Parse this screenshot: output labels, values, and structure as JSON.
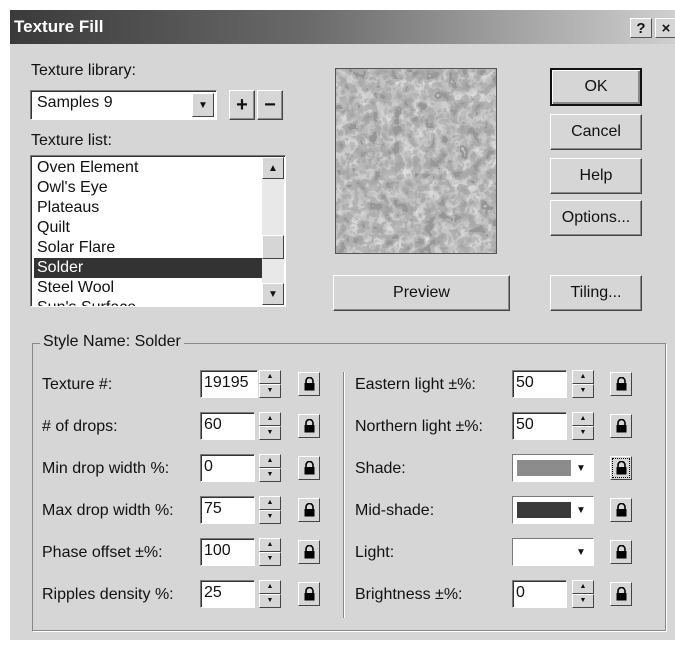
{
  "window": {
    "title": "Texture Fill",
    "help_glyph": "?",
    "close_glyph": "×"
  },
  "library": {
    "label": "Texture library:",
    "value": "Samples 9",
    "add": "+",
    "remove": "−"
  },
  "texture_list": {
    "label": "Texture list:",
    "items": [
      "Oven Element",
      "Owl's Eye",
      "Plateaus",
      "Quilt",
      "Solar Flare",
      "Solder",
      "Steel Wool",
      "Sun's Surface"
    ],
    "selected": "Solder"
  },
  "buttons": {
    "ok": "OK",
    "cancel": "Cancel",
    "help": "Help",
    "options": "Options...",
    "preview": "Preview",
    "tiling": "Tiling..."
  },
  "style": {
    "group_title": "Style Name: Solder",
    "left_params": [
      {
        "label": "Texture #:",
        "value": "19195"
      },
      {
        "label": "# of drops:",
        "value": "60"
      },
      {
        "label": "Min drop width %:",
        "value": "0"
      },
      {
        "label": "Max drop width %:",
        "value": "75"
      },
      {
        "label": "Phase offset ±%:",
        "value": "100"
      },
      {
        "label": "Ripples density %:",
        "value": "25"
      }
    ],
    "right_params": [
      {
        "label": "Eastern light ±%:",
        "value": "50"
      },
      {
        "label": "Northern light ±%:",
        "value": "50"
      },
      {
        "label": "Shade:",
        "color": "#8c8c8c"
      },
      {
        "label": "Mid-shade:",
        "color": "#3a3a3a"
      },
      {
        "label": "Light:",
        "color": "#ffffff"
      },
      {
        "label": "Brightness ±%:",
        "value": "0"
      }
    ]
  }
}
